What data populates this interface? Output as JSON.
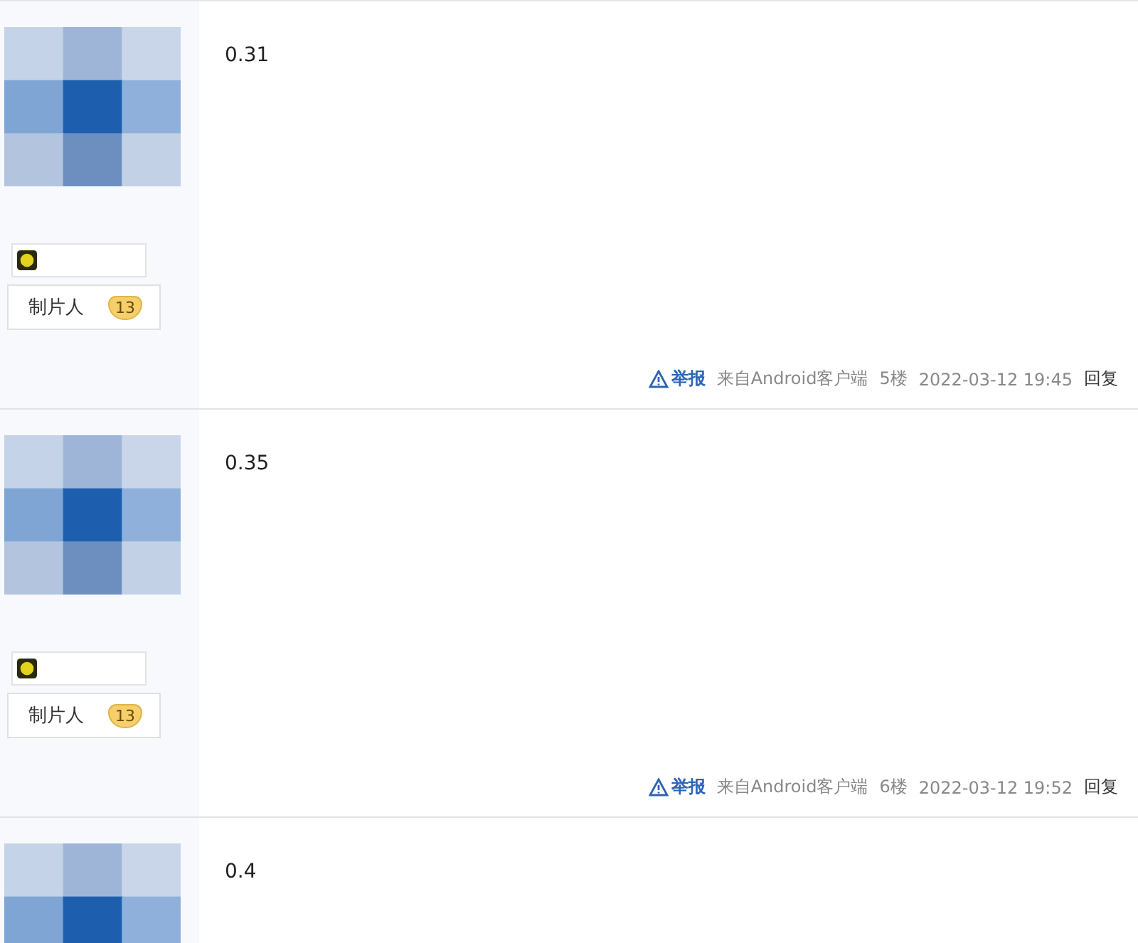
{
  "posts": [
    {
      "content": "0.31",
      "title": "制片人",
      "level": "13",
      "report": "举报",
      "source": "来自Android客户端",
      "floor": "5楼",
      "time": "2022-03-12 19:45",
      "reply": "回复"
    },
    {
      "content": "0.35",
      "title": "制片人",
      "level": "13",
      "report": "举报",
      "source": "来自Android客户端",
      "floor": "6楼",
      "time": "2022-03-12 19:52",
      "reply": "回复"
    },
    {
      "content": "0.4"
    }
  ]
}
